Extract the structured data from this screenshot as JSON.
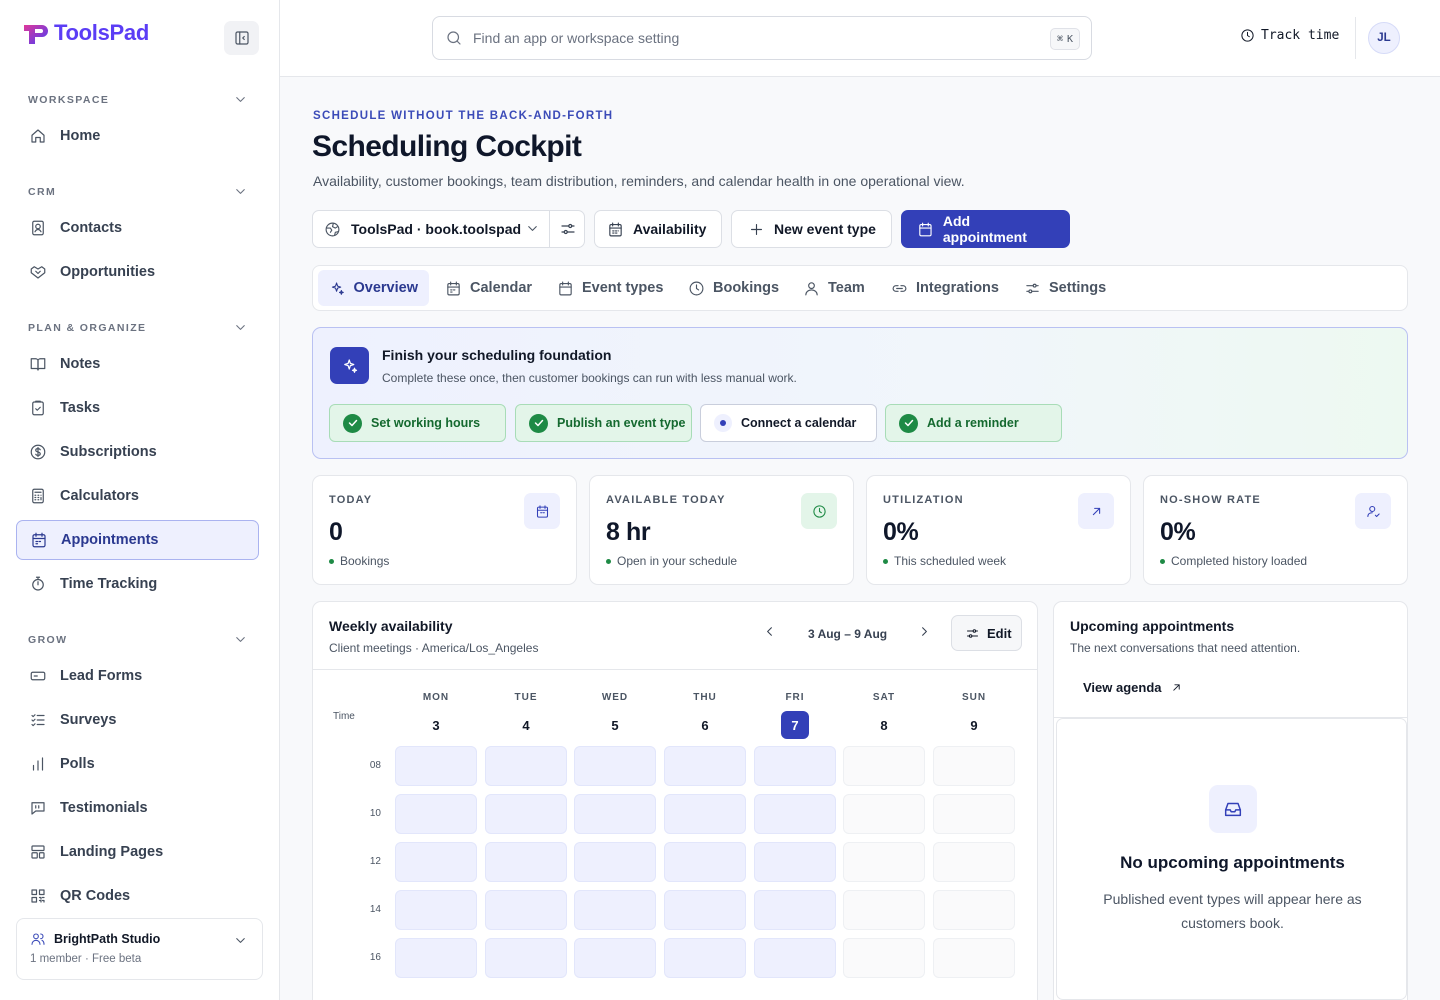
{
  "brand": {
    "name": "ToolsPad",
    "color": "#5b3df5"
  },
  "sidebar": {
    "sections": [
      {
        "title": "WORKSPACE",
        "items": [
          {
            "label": "Home",
            "icon": "home-icon"
          }
        ]
      },
      {
        "title": "CRM",
        "items": [
          {
            "label": "Contacts",
            "icon": "contact-card-icon"
          },
          {
            "label": "Opportunities",
            "icon": "handshake-icon"
          }
        ]
      },
      {
        "title": "PLAN & ORGANIZE",
        "items": [
          {
            "label": "Notes",
            "icon": "book-icon"
          },
          {
            "label": "Tasks",
            "icon": "clipboard-check-icon"
          },
          {
            "label": "Subscriptions",
            "icon": "dollar-circle-icon"
          },
          {
            "label": "Calculators",
            "icon": "calculator-icon"
          },
          {
            "label": "Appointments",
            "icon": "calendar-icon",
            "active": true
          },
          {
            "label": "Time Tracking",
            "icon": "stopwatch-icon"
          }
        ]
      },
      {
        "title": "GROW",
        "items": [
          {
            "label": "Lead Forms",
            "icon": "form-icon"
          },
          {
            "label": "Surveys",
            "icon": "checklist-icon"
          },
          {
            "label": "Polls",
            "icon": "bar-chart-icon"
          },
          {
            "label": "Testimonials",
            "icon": "quote-message-icon"
          },
          {
            "label": "Landing Pages",
            "icon": "layout-icon"
          },
          {
            "label": "QR Codes",
            "icon": "qr-code-icon"
          }
        ]
      }
    ],
    "workspace": {
      "name": "BrightPath Studio",
      "meta": "1 member · Free beta"
    }
  },
  "topbar": {
    "search_placeholder": "Find an app or workspace setting",
    "shortcut_key": "K",
    "track_time": "Track time",
    "avatar_initials": "JL"
  },
  "page": {
    "eyebrow": "SCHEDULE WITHOUT THE BACK-AND-FORTH",
    "title": "Scheduling Cockpit",
    "subtitle": "Availability, customer bookings, team distribution, reminders, and calendar health in one operational view."
  },
  "actions": {
    "workspace_select": "ToolsPad · book.toolspad",
    "availability": "Availability",
    "new_event_type": "New event type",
    "add_appointment": "Add appointment",
    "accent": "#3340b8"
  },
  "tabs": [
    {
      "label": "Overview",
      "active": true
    },
    {
      "label": "Calendar"
    },
    {
      "label": "Event types"
    },
    {
      "label": "Bookings"
    },
    {
      "label": "Team"
    },
    {
      "label": "Integrations"
    },
    {
      "label": "Settings"
    }
  ],
  "foundation": {
    "title": "Finish your scheduling foundation",
    "subtitle": "Complete these once, then customer bookings can run with less manual work.",
    "steps": [
      {
        "label": "Set working hours",
        "done": true
      },
      {
        "label": "Publish an event type",
        "done": true
      },
      {
        "label": "Connect a calendar",
        "done": false
      },
      {
        "label": "Add a reminder",
        "done": true
      }
    ]
  },
  "stats": [
    {
      "label": "TODAY",
      "value": "0",
      "note": "Bookings",
      "icon": "calendar-icon"
    },
    {
      "label": "AVAILABLE TODAY",
      "value": "8 hr",
      "note": "Open in your schedule",
      "icon": "clock-icon"
    },
    {
      "label": "UTILIZATION",
      "value": "0%",
      "note": "This scheduled week",
      "icon": "arrow-up-right-icon"
    },
    {
      "label": "NO-SHOW RATE",
      "value": "0%",
      "note": "Completed history loaded",
      "icon": "user-check-icon"
    }
  ],
  "weekly": {
    "title": "Weekly availability",
    "subtitle": "Client meetings · America/Los_Angeles",
    "range": "3 Aug – 9 Aug",
    "edit": "Edit",
    "time_label": "Time",
    "days": [
      {
        "name": "MON",
        "num": "3",
        "available": true
      },
      {
        "name": "TUE",
        "num": "4",
        "available": true
      },
      {
        "name": "WED",
        "num": "5",
        "available": true
      },
      {
        "name": "THU",
        "num": "6",
        "available": true
      },
      {
        "name": "FRI",
        "num": "7",
        "available": true,
        "today": true
      },
      {
        "name": "SAT",
        "num": "8",
        "available": false
      },
      {
        "name": "SUN",
        "num": "9",
        "available": false
      }
    ],
    "hours": [
      "08",
      "10",
      "12",
      "14",
      "16"
    ]
  },
  "upcoming": {
    "title": "Upcoming appointments",
    "subtitle": "The next conversations that need attention.",
    "link": "View agenda",
    "empty_title": "No upcoming appointments",
    "empty_sub": "Published event types will appear here as customers book."
  }
}
